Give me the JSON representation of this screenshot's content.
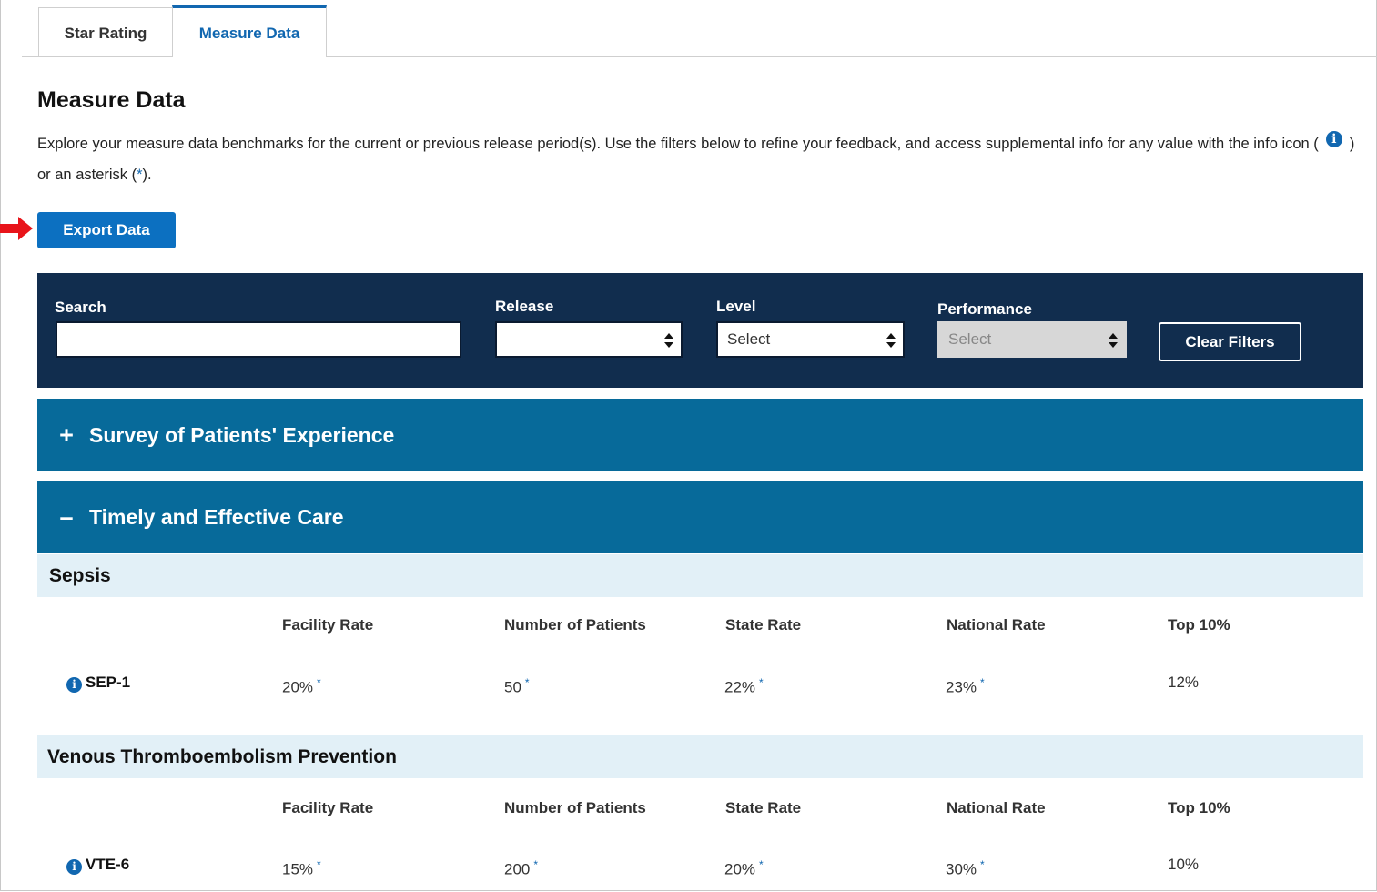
{
  "tabs": [
    {
      "label": "Star Rating",
      "active": false
    },
    {
      "label": "Measure Data",
      "active": true
    }
  ],
  "page": {
    "title": "Measure Data",
    "intro_part1": "Explore your measure data benchmarks for the current or previous release period(s). Use the filters below to refine your feedback, and access supplemental info for any value with the info icon (",
    "intro_part2": ") or an asterisk (",
    "intro_asterisk": "*",
    "intro_part3": ").",
    "export_label": "Export Data"
  },
  "filters": {
    "search_label": "Search",
    "search_value": "",
    "release_label": "Release",
    "release_value": "",
    "level_label": "Level",
    "level_value": "Select",
    "performance_label": "Performance",
    "performance_value": "Select",
    "clear_label": "Clear Filters"
  },
  "accordions": [
    {
      "title": "Survey of Patients' Experience",
      "icon": "+",
      "expanded": false
    },
    {
      "title": "Timely and Effective Care",
      "icon": "–",
      "expanded": true
    }
  ],
  "columns": [
    "Facility Rate",
    "Number of Patients",
    "State Rate",
    "National Rate",
    "Top 10%"
  ],
  "asterisk": "*",
  "sections": [
    {
      "title": "Sepsis",
      "rows": [
        {
          "measure": "SEP-1",
          "facility_rate": "20%",
          "patients": "50",
          "state_rate": "22%",
          "national_rate": "23%",
          "top10": "12%"
        }
      ]
    },
    {
      "title": "Venous Thromboembolism Prevention",
      "rows": [
        {
          "measure": "VTE-6",
          "facility_rate": "15%",
          "patients": "200",
          "state_rate": "20%",
          "national_rate": "30%",
          "top10": "10%"
        }
      ]
    }
  ],
  "colors": {
    "tab_active": "#1167b0",
    "primary_button": "#0c70c1",
    "filter_panel": "#112d4e",
    "accordion": "#076a9a",
    "section_header": "#e2f0f7",
    "annotation_arrow": "#e8141a"
  }
}
